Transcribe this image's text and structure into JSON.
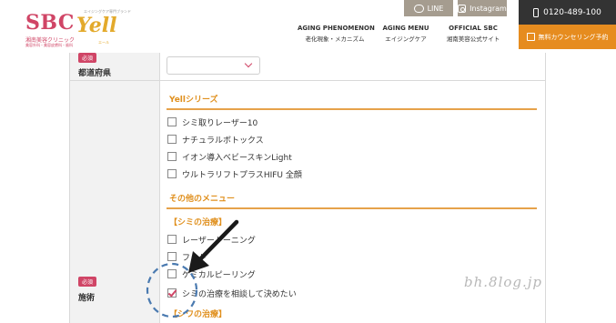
{
  "header": {
    "logo": {
      "brand": "SBC",
      "sub": "湘南美容クリニック",
      "sub_small": "美容外科・美容皮膚科・歯科",
      "yell": "Yell",
      "yell_tagline": "エイジングケア専門ブランド",
      "yell_sub": "エール"
    },
    "social": {
      "line_label": "LINE",
      "instagram_label": "Instagram"
    },
    "nav": [
      {
        "en": "AGING PHENOMENON",
        "jp": "老化現象・メカニズム"
      },
      {
        "en": "AGING MENU",
        "jp": "エイジングケア"
      },
      {
        "en": "OFFICIAL SBC",
        "jp": "湘南美容公式サイト"
      }
    ],
    "phone": "0120-489-100",
    "counseling": "無料カウンセリング予約"
  },
  "form": {
    "required_badge": "必須",
    "prefecture_label": "都道府県",
    "prefecture_value": "",
    "treatment_label": "施術",
    "yell_series": {
      "title": "Yellシリーズ",
      "options": [
        {
          "label": "シミ取りレーザー10",
          "checked": false
        },
        {
          "label": "ナチュラルボトックス",
          "checked": false
        },
        {
          "label": "イオン導入ベビースキンLight",
          "checked": false
        },
        {
          "label": "ウルトラリフトプラスHIFU 全顔",
          "checked": false
        }
      ]
    },
    "other_menu": {
      "title": "その他のメニュー",
      "subsections": [
        {
          "title": "【シミの治療】",
          "options": [
            {
              "label": "レーザートーニング",
              "checked": false
            },
            {
              "label": "フォト",
              "checked": false
            },
            {
              "label": "ケミカルピーリング",
              "checked": false
            },
            {
              "label": "シミの治療を相談して決めたい",
              "checked": true
            }
          ]
        },
        {
          "title": "【シワの治療】",
          "options": []
        }
      ]
    }
  },
  "watermark": "bh.8log.jp",
  "colors": {
    "brand_pink": "#d04566",
    "accent_orange": "#e0901e",
    "social_gray": "#a59c8f",
    "annotation_blue": "#4a7ab0"
  }
}
